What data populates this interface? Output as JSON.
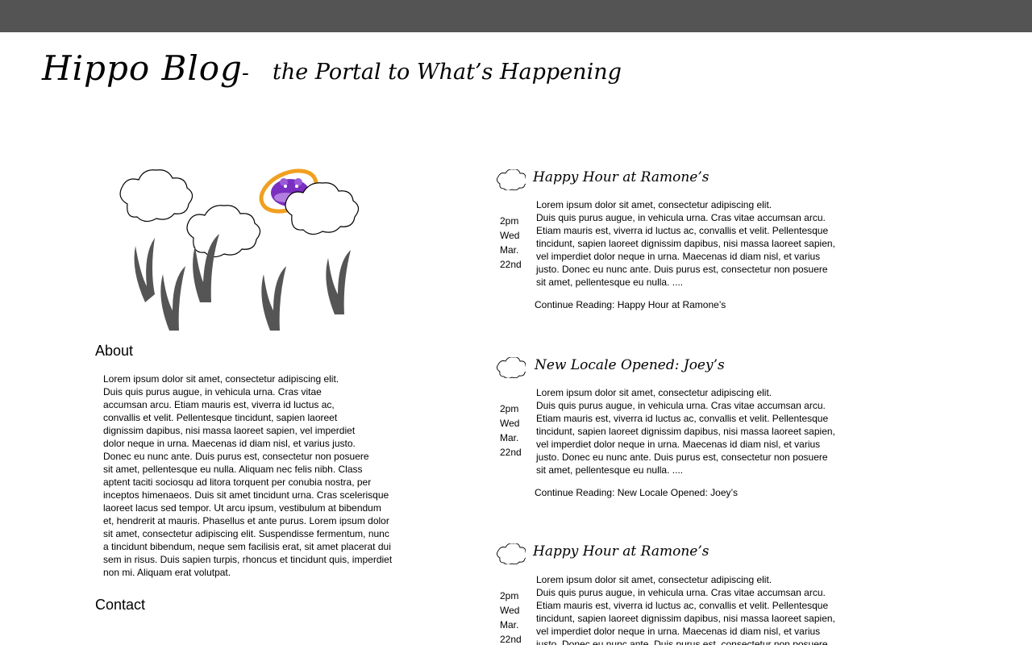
{
  "site": {
    "title": "Hippo Blog",
    "separator": "-",
    "tagline": "the Portal to What’s Happening"
  },
  "sidebar": {
    "about_heading": "About",
    "about_text": "Lorem ipsum dolor sit amet, consectetur adipiscing elit.\nDuis quis purus augue, in vehicula urna. Cras vitae\naccumsan arcu. Etiam mauris est, viverra id luctus ac,\nconvallis et velit. Pellentesque tincidunt, sapien laoreet\ndignissim dapibus, nisi massa laoreet sapien, vel imperdiet\ndolor neque in urna. Maecenas id diam nisl, et varius justo.\nDonec eu nunc ante. Duis purus est, consectetur non posuere\nsit amet, pellentesque eu nulla. Aliquam nec felis nibh. Class\naptent taciti sociosqu ad litora torquent per conubia nostra, per\ninceptos himenaeos. Duis sit amet tincidunt urna. Cras scelerisque\nlaoreet lacus sed tempor. Ut arcu ipsum, vestibulum at bibendum\net, hendrerit at mauris. Phasellus et ante purus. Lorem ipsum dolor\nsit amet, consectetur adipiscing elit. Suspendisse fermentum, nunc\na tincidunt bibendum, neque sem facilisis erat, sit amet placerat dui\nsem in risus. Duis sapien turpis, rhoncus et tincidunt quis, imperdiet\nnon mi. Aliquam erat volutpat.",
    "contact_heading": "Contact"
  },
  "posts": [
    {
      "title": "Happy Hour at Ramone’s",
      "date": {
        "time": "2pm",
        "day": "Wed",
        "month": "Mar.",
        "date": "22nd"
      },
      "excerpt": "Lorem ipsum dolor sit amet, consectetur adipiscing elit.\nDuis quis purus augue, in vehicula urna. Cras vitae accumsan arcu.\nEtiam mauris est, viverra id luctus ac, convallis et velit. Pellentesque\ntincidunt, sapien laoreet dignissim dapibus, nisi massa laoreet sapien,\nvel imperdiet dolor neque in urna. Maecenas id diam nisl, et varius\njusto. Donec eu nunc ante. Duis purus est, consectetur non posuere\nsit amet, pellentesque eu nulla. ....",
      "continue_link": "Continue Reading: Happy Hour at Ramone’s"
    },
    {
      "title": "New Locale Opened: Joey’s",
      "date": {
        "time": "2pm",
        "day": "Wed",
        "month": "Mar.",
        "date": "22nd"
      },
      "excerpt": "Lorem ipsum dolor sit amet, consectetur adipiscing elit.\nDuis quis purus augue, in vehicula urna. Cras vitae accumsan arcu.\nEtiam mauris est, viverra id luctus ac, convallis et velit. Pellentesque\ntincidunt, sapien laoreet dignissim dapibus, nisi massa laoreet sapien,\nvel imperdiet dolor neque in urna. Maecenas id diam nisl, et varius\njusto. Donec eu nunc ante. Duis purus est, consectetur non posuere\nsit amet, pellentesque eu nulla. ....",
      "continue_link": "Continue Reading: New Locale Opened: Joey’s"
    },
    {
      "title": "Happy Hour at Ramone’s",
      "date": {
        "time": "2pm",
        "day": "Wed",
        "month": "Mar.",
        "date": "22nd"
      },
      "excerpt": "Lorem ipsum dolor sit amet, consectetur adipiscing elit.\nDuis quis purus augue, in vehicula urna. Cras vitae accumsan arcu.\nEtiam mauris est, viverra id luctus ac, convallis et velit. Pellentesque\ntincidunt, sapien laoreet dignissim dapibus, nisi massa laoreet sapien,\nvel imperdiet dolor neque in urna. Maecenas id diam nisl, et varius\njusto. Donec eu nunc ante. Duis purus est, consectetur non posuere",
      "continue_link": ""
    }
  ],
  "icons": {
    "post_icon": "cloud-icon",
    "illustration": "clouds-grass-hippo-logo"
  },
  "colors": {
    "topbar": "#545454",
    "hippo_purple": "#7a2fc0",
    "ring_orange": "#f0a020",
    "grass": "#555555"
  }
}
